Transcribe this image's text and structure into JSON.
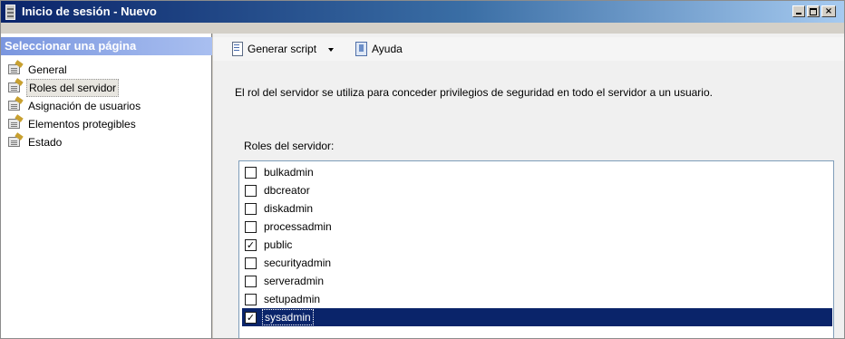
{
  "window": {
    "title": "Inicio de sesión - Nuevo",
    "controls": {
      "minimize": "_",
      "maximize": "□",
      "close": "×"
    }
  },
  "sidebar": {
    "header": "Seleccionar una página",
    "items": [
      {
        "label": "General",
        "icon": "page-icon",
        "selected": false
      },
      {
        "label": "Roles del servidor",
        "icon": "page-icon",
        "selected": true
      },
      {
        "label": "Asignación de usuarios",
        "icon": "page-icon",
        "selected": false
      },
      {
        "label": "Elementos protegibles",
        "icon": "page-icon",
        "selected": false
      },
      {
        "label": "Estado",
        "icon": "page-icon",
        "selected": false
      }
    ]
  },
  "toolbar": {
    "script_label": "Generar script",
    "help_label": "Ayuda"
  },
  "main": {
    "description": "El rol del servidor se utiliza para conceder privilegios de seguridad en todo el servidor a un usuario.",
    "roles_label": "Roles del servidor:",
    "roles": [
      {
        "name": "bulkadmin",
        "checked": false
      },
      {
        "name": "dbcreator",
        "checked": false
      },
      {
        "name": "diskadmin",
        "checked": false
      },
      {
        "name": "processadmin",
        "checked": false
      },
      {
        "name": "public",
        "checked": true
      },
      {
        "name": "securityadmin",
        "checked": false
      },
      {
        "name": "serveradmin",
        "checked": false
      },
      {
        "name": "setupadmin",
        "checked": false
      },
      {
        "name": "sysadmin",
        "checked": true,
        "selected": true
      }
    ]
  },
  "colors": {
    "title_bar_start": "#0a246a",
    "sidebar_header_start": "#7a96df",
    "selection": "#0a246a"
  }
}
